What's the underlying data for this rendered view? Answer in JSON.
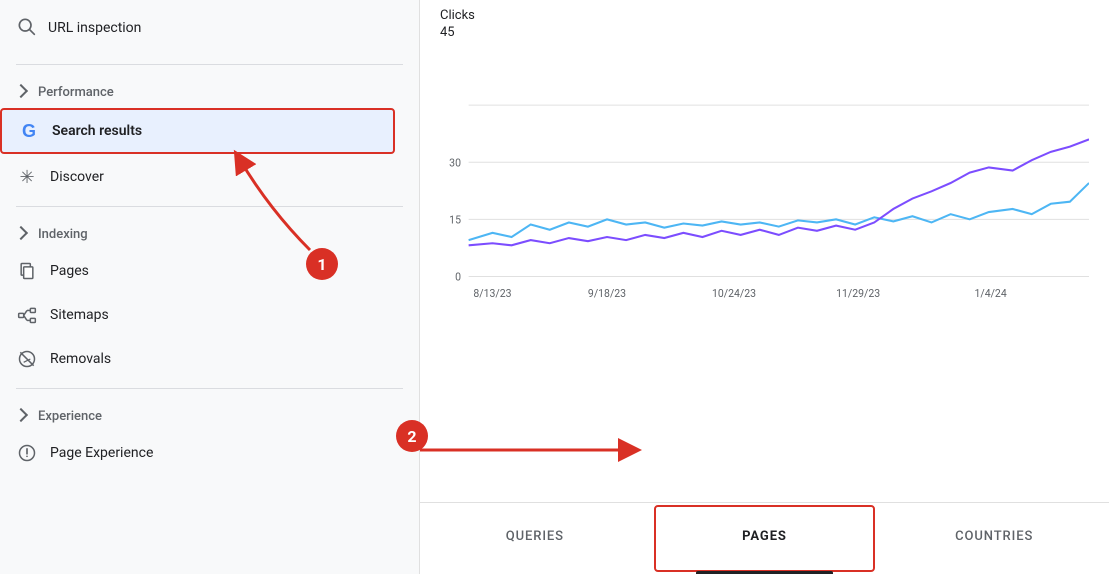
{
  "sidebar": {
    "url_inspection_label": "URL inspection",
    "performance_label": "Performance",
    "search_results_label": "Search results",
    "discover_label": "Discover",
    "indexing_label": "Indexing",
    "pages_label": "Pages",
    "sitemaps_label": "Sitemaps",
    "removals_label": "Removals",
    "experience_label": "Experience",
    "page_experience_label": "Page Experience"
  },
  "chart": {
    "y_label": "Clicks",
    "y_value": "45",
    "y_ticks": [
      "0",
      "15",
      "30"
    ],
    "x_ticks": [
      "8/13/23",
      "9/18/23",
      "10/24/23",
      "11/29/23",
      "1/4/24"
    ],
    "colors": {
      "blue": "#4db6f4",
      "purple": "#7c4dff"
    }
  },
  "tabs": {
    "queries_label": "QUERIES",
    "pages_label": "PAGES",
    "countries_label": "COUNTRIES"
  },
  "annotations": {
    "badge1": "1",
    "badge2": "2"
  }
}
